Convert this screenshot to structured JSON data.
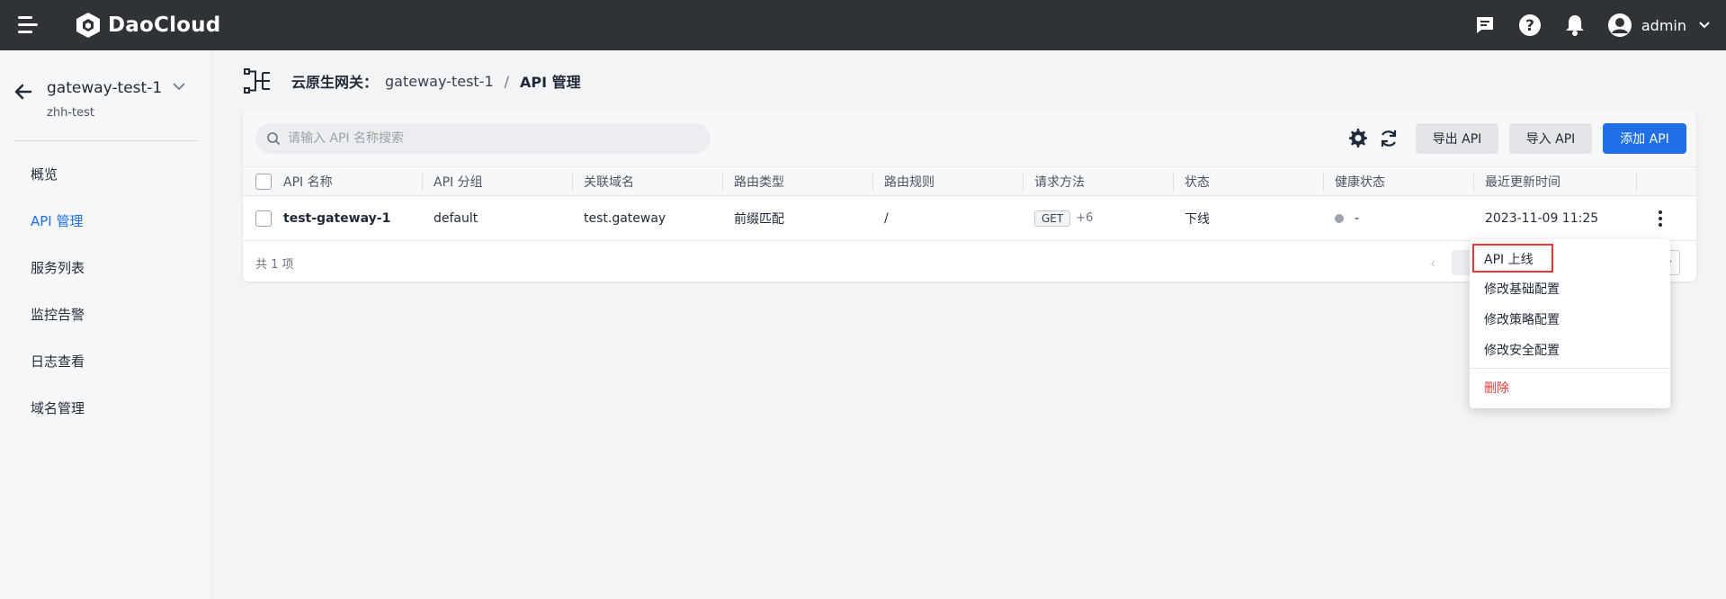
{
  "topbar": {
    "brand": "DaoCloud",
    "icons": [
      "menu-icon",
      "message-icon",
      "help-icon",
      "bell-icon",
      "user-avatar-icon",
      "chevron-down-icon"
    ],
    "username": "admin"
  },
  "sidebar": {
    "gateway_name": "gateway-test-1",
    "namespace": "zhh-test",
    "items": [
      {
        "label": "概览",
        "active": false
      },
      {
        "label": "API 管理",
        "active": true
      },
      {
        "label": "服务列表",
        "active": false
      },
      {
        "label": "监控告警",
        "active": false
      },
      {
        "label": "日志查看",
        "active": false
      },
      {
        "label": "域名管理",
        "active": false
      }
    ]
  },
  "breadcrumb": {
    "parent": "云原生网关：",
    "gateway": "gateway-test-1",
    "separator": "/",
    "current": "API 管理"
  },
  "toolbar": {
    "search_placeholder": "请输入 API 名称搜索",
    "export_label": "导出 API",
    "import_label": "导入 API",
    "add_label": "添加 API"
  },
  "table": {
    "columns": [
      "API 名称",
      "API 分组",
      "关联域名",
      "路由类型",
      "路由规则",
      "请求方法",
      "状态",
      "健康状态",
      "最近更新时间"
    ],
    "rows": [
      {
        "name": "test-gateway-1",
        "group": "default",
        "domain": "test.gateway",
        "route_type": "前缀匹配",
        "route_rule": "/",
        "method": "GET",
        "method_more": "+6",
        "status": "下线",
        "health": "-",
        "updated": "2023-11-09 11:25"
      }
    ],
    "total": "共 1 项"
  },
  "dropdown": {
    "items": [
      {
        "label": "API 上线",
        "danger": false
      },
      {
        "label": "修改基础配置",
        "danger": false
      },
      {
        "label": "修改策略配置",
        "danger": false
      },
      {
        "label": "修改安全配置",
        "danger": false
      },
      {
        "label": "删除",
        "danger": true
      }
    ]
  },
  "colors": {
    "topbar": "#2f3337",
    "primary": "#1e6fe8",
    "danger": "#e53935"
  }
}
